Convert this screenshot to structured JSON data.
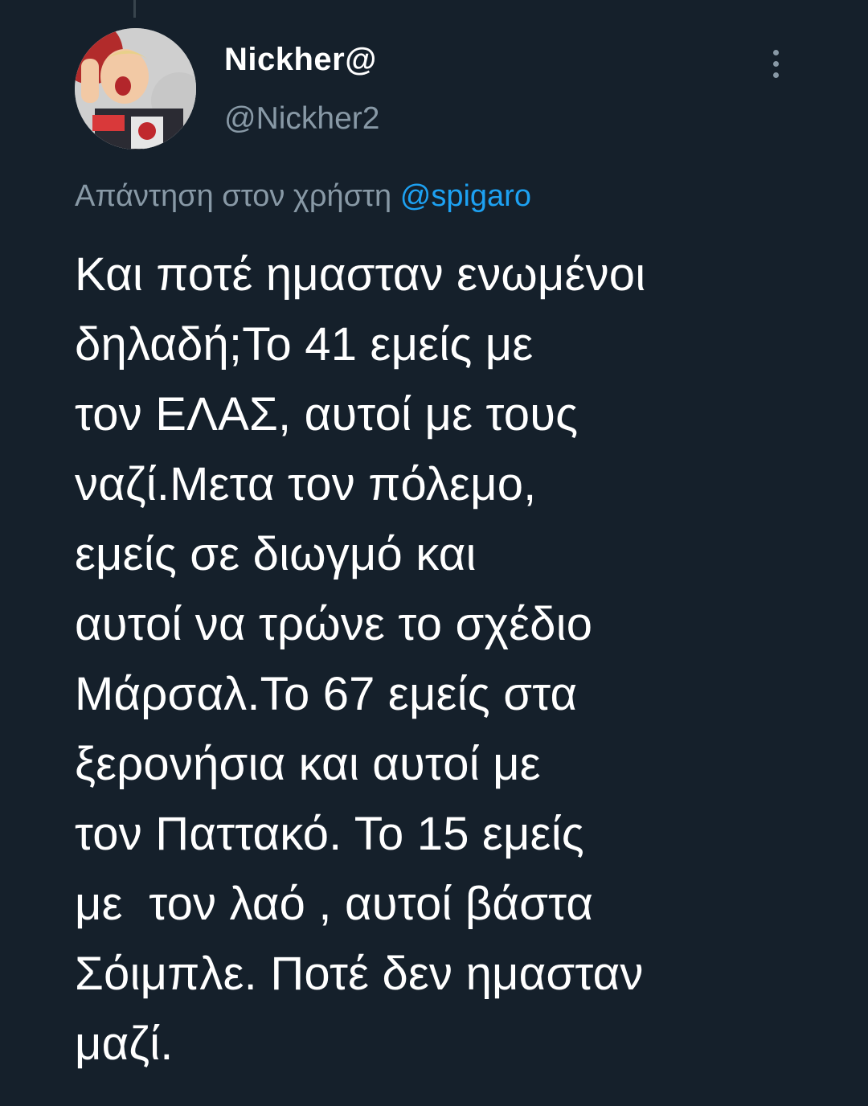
{
  "tweet": {
    "author": {
      "display_name": "Nickher@",
      "handle": "@Nickher2"
    },
    "reply": {
      "prefix": "Απάντηση στον χρήστη",
      "mention": "@spigaro"
    },
    "text": "Και ποτέ ημασταν ενωμένοι\nδηλαδή;Το 41 εμείς με\nτον ΕΛΑΣ, αυτοί με τους\nναζί.Μετα τον πόλεμο,\nεμείς σε διωγμό και\nαυτοί να τρώνε το σχέδιο\nΜάρσαλ.Το 67 εμείς στα\nξερονήσια και αυτοί με\nτον Παττακό. Το 15 εμείς\nμε  τον λαό , αυτοί βάστα\nΣόιμπλε. Ποτέ δεν ημασταν\nμαζί."
  },
  "icons": {
    "more": "more-vertical-icon",
    "avatar": "profile-photo"
  },
  "colors": {
    "background": "#15202b",
    "primary_text": "#ffffff",
    "secondary_text": "#8899a6",
    "link": "#1da1f2"
  }
}
